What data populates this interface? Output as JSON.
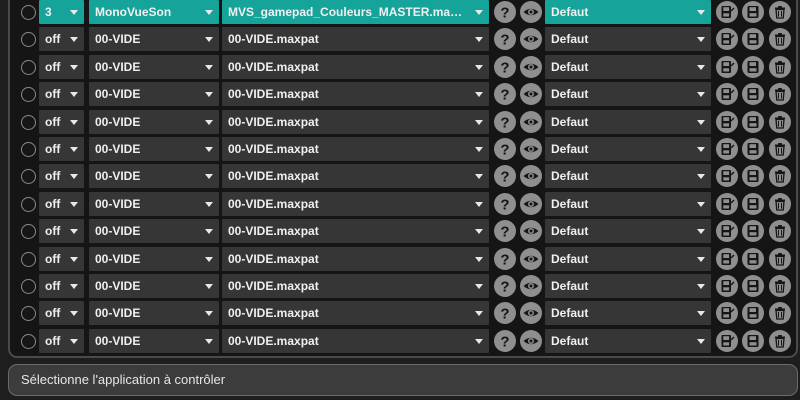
{
  "rows": [
    {
      "state": "3",
      "app": "MonoVueSon",
      "patch": "MVS_gamepad_Couleurs_MASTER.maxpat",
      "preset": "Defaut",
      "active": true
    },
    {
      "state": "off",
      "app": "00-VIDE",
      "patch": "00-VIDE.maxpat",
      "preset": "Defaut",
      "active": false
    },
    {
      "state": "off",
      "app": "00-VIDE",
      "patch": "00-VIDE.maxpat",
      "preset": "Defaut",
      "active": false
    },
    {
      "state": "off",
      "app": "00-VIDE",
      "patch": "00-VIDE.maxpat",
      "preset": "Defaut",
      "active": false
    },
    {
      "state": "off",
      "app": "00-VIDE",
      "patch": "00-VIDE.maxpat",
      "preset": "Defaut",
      "active": false
    },
    {
      "state": "off",
      "app": "00-VIDE",
      "patch": "00-VIDE.maxpat",
      "preset": "Defaut",
      "active": false
    },
    {
      "state": "off",
      "app": "00-VIDE",
      "patch": "00-VIDE.maxpat",
      "preset": "Defaut",
      "active": false
    },
    {
      "state": "off",
      "app": "00-VIDE",
      "patch": "00-VIDE.maxpat",
      "preset": "Defaut",
      "active": false
    },
    {
      "state": "off",
      "app": "00-VIDE",
      "patch": "00-VIDE.maxpat",
      "preset": "Defaut",
      "active": false
    },
    {
      "state": "off",
      "app": "00-VIDE",
      "patch": "00-VIDE.maxpat",
      "preset": "Defaut",
      "active": false
    },
    {
      "state": "off",
      "app": "00-VIDE",
      "patch": "00-VIDE.maxpat",
      "preset": "Defaut",
      "active": false
    },
    {
      "state": "off",
      "app": "00-VIDE",
      "patch": "00-VIDE.maxpat",
      "preset": "Defaut",
      "active": false
    },
    {
      "state": "off",
      "app": "00-VIDE",
      "patch": "00-VIDE.maxpat",
      "preset": "Defaut",
      "active": false
    }
  ],
  "status": {
    "text": "Sélectionne l'application à contrôler"
  },
  "colors": {
    "accent": "#15a39a",
    "dropdown": "#363636",
    "icon": "#8f8f8f"
  },
  "icons": [
    "radio-icon",
    "chevron-down-icon",
    "help-icon",
    "eye-icon",
    "save-as-icon",
    "save-icon",
    "trash-icon"
  ]
}
